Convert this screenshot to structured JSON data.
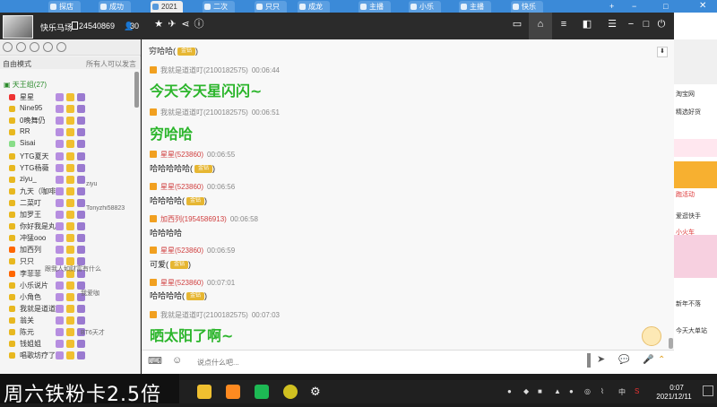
{
  "browser_tabs": [
    {
      "label": "探店"
    },
    {
      "label": "成功"
    },
    {
      "label": "2021"
    },
    {
      "label": "二次"
    },
    {
      "label": "只只"
    },
    {
      "label": "成龙"
    },
    {
      "label": "主播"
    },
    {
      "label": "小乐"
    },
    {
      "label": "主播"
    },
    {
      "label": "快乐"
    }
  ],
  "header": {
    "room_name": "快乐马场",
    "room_id": "24540869",
    "online_count": "30"
  },
  "left_panel": {
    "mode_label": "自由模式",
    "mode_right": "所有人可以发言",
    "group_label": "天王组(27)",
    "members": [
      {
        "name": "星星",
        "color": "#e33"
      },
      {
        "name": "Nine95",
        "color": "#e8b820"
      },
      {
        "name": "0晚舞仍",
        "color": "#e8b820"
      },
      {
        "name": "RR",
        "color": "#e8b820"
      },
      {
        "name": "Sisai",
        "color": "#8d8"
      },
      {
        "name": "YTG夏天",
        "color": "#e8b820"
      },
      {
        "name": "YTG杨薇",
        "color": "#e8b820"
      },
      {
        "name": "ziyu_",
        "color": "#e8b820"
      },
      {
        "name": "九天（咖啡）",
        "color": "#e8b820"
      },
      {
        "name": "二菜叮",
        "color": "#e8b820"
      },
      {
        "name": "加罗王",
        "color": "#e8b820"
      },
      {
        "name": "你好我是丸子",
        "color": "#e8b820"
      },
      {
        "name": "冲猛ooo",
        "color": "#e8b820"
      },
      {
        "name": "加西列",
        "color": "#f60"
      },
      {
        "name": "只只",
        "color": "#e8b820"
      },
      {
        "name": "李菲菲",
        "color": "#f60"
      },
      {
        "name": "小乐说片",
        "color": "#e8b820"
      },
      {
        "name": "小角色",
        "color": "#e8b820"
      },
      {
        "name": "我就是道道叮",
        "color": "#e8b820"
      },
      {
        "name": "翁关",
        "color": "#e8b820"
      },
      {
        "name": "陈元",
        "color": "#e8b820"
      },
      {
        "name": "钱姐姐",
        "color": "#e8b820"
      },
      {
        "name": "唱歌坊疗了",
        "color": "#e8b820"
      }
    ],
    "member_extras": [
      "Tonyzhi58823",
      "ziyu",
      "我爱咖",
      "BT6天才",
      "跟我人如财富有什么"
    ]
  },
  "chat": {
    "messages": [
      {
        "user": "穷哈哈",
        "badge": "金钻",
        "time": "",
        "text": ""
      },
      {
        "user": "我就是道道叮(2100182575)",
        "badge": "",
        "time": "00:06:44",
        "text": "今天今天星闪闪~",
        "big": true
      },
      {
        "user": "我就是道道叮(2100182575)",
        "badge": "",
        "time": "00:06:51",
        "text": "穷哈哈",
        "big": true
      },
      {
        "user": "星星(523860)",
        "badge": "",
        "time": "00:06:55",
        "text": "哈哈哈哈哈",
        "tag": "金钻"
      },
      {
        "user": "星星(523860)",
        "badge": "",
        "time": "00:06:56",
        "text": "哈哈哈哈",
        "tag": "金钻"
      },
      {
        "user": "加西列(1954586913)",
        "badge": "",
        "time": "00:06:58",
        "text": "哈哈哈哈"
      },
      {
        "user": "星星(523860)",
        "badge": "",
        "time": "00:06:59",
        "text": "可爱",
        "tag": "金钻"
      },
      {
        "user": "星星(523860)",
        "badge": "",
        "time": "00:07:01",
        "text": "哈哈哈哈",
        "tag": "金钻"
      },
      {
        "user": "我就是道道叮(2100182575)",
        "badge": "",
        "time": "00:07:03",
        "text": "晒太阳了啊~",
        "big": true
      }
    ],
    "input_placeholder": "说点什么吧..."
  },
  "right_panel": {
    "items": [
      "淘宝网",
      "精选好货",
      "跑活动",
      "爱逛快手",
      "小火车",
      "新年不落",
      "今天大单站"
    ]
  },
  "taskbar": {
    "overlay": "周六铁粉卡2.5倍",
    "time": "0:07",
    "date": "2021/12/11",
    "ime": "中"
  },
  "colors": {
    "header_bg": "#2b2b2b",
    "chat_green": "#2bb52b",
    "name_red": "#d04040",
    "tab_blue": "#3b8ad8"
  }
}
